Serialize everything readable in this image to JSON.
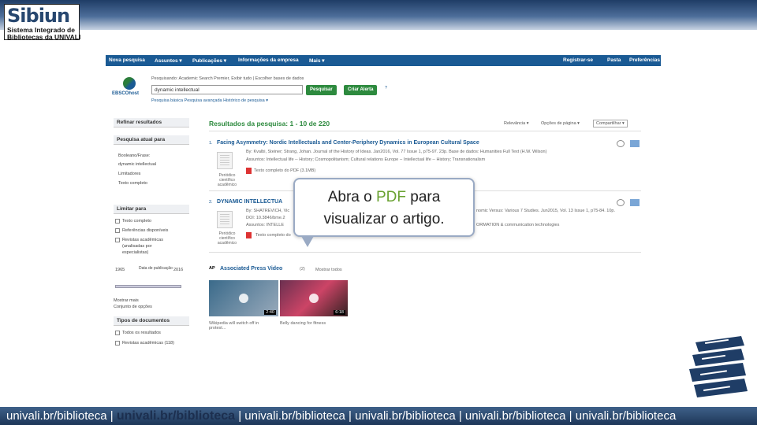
{
  "logo": {
    "title": "Sibiun",
    "line1": "Sistema Integrado de",
    "line2": "Bibliotecas da UNIVALI"
  },
  "nav": {
    "items": [
      "Nova pesquisa",
      "Assuntos ▾",
      "Publicações ▾",
      "Informações da empresa",
      "Mais ▾"
    ],
    "right": [
      "Registrar-se",
      "Pasta",
      "Preferências"
    ]
  },
  "search": {
    "scope": "Pesquisando: Academic Search Premier, Exibir tudo  |  Escolher bases de dados",
    "query": "dynamic intellectual",
    "btn_search": "Pesquisar",
    "btn_alert": "Criar Alerta",
    "help": "?",
    "links": "Pesquisa básica  Pesquisa avançada  Histórico de pesquisa ▾",
    "brand": "EBSCOhost"
  },
  "left": {
    "refine": "Refinar resultados",
    "current": "Pesquisa atual para",
    "boolean_label": "Booleano/Frase:",
    "boolean_value": "dynamic intellectual",
    "limiters": "Limitadores",
    "fulltext": "Texto completo",
    "limit_to": "Limitar para",
    "opt1": "Texto completo",
    "opt2": "Referências disponíveis",
    "opt3": "Revistas acadêmicas",
    "opt3b": "(analisadas por",
    "opt3c": "especialistas)",
    "year_from": "1965",
    "year_label": "Data de publicação",
    "year_to": "2016",
    "show_more": "Mostrar mais",
    "options": "Conjunto de opções",
    "doc_types": "Tipos de documentos",
    "dt1": "Todos os resultados",
    "dt2": "Revistas acadêmicas (118)"
  },
  "results": {
    "title": "Resultados da pesquisa: 1 - 10 de 220",
    "sort": "Relevância ▾",
    "page_opts": "Opções de página ▾",
    "share": "Compartilhar ▾",
    "r1_num": "1.",
    "r1_title": "Facing Asymmetry: Nordic Intellectuals and Center-Periphery Dynamics in European Cultural Space",
    "r1_meta1": "By: Kvalbi, Steiner; Strang, Johan. Journal of the History of Ideas. Jan2016, Vol. 77 Issue 1, p75-97. 23p. Base de dados: Humanities Full Text (H.W. Wilson)",
    "r1_meta2": "Assuntos: Intellectual life -- History; Cosmopolitanism; Cultural relations Europe -- Intellectual life -- History; Transnationalism",
    "r1_pdf": "Texto completo do PDF (3.1MB)",
    "r1_type": "Periódico científico acadêmico",
    "r2_num": "2.",
    "r2_title": "DYNAMIC INTELLECTUA",
    "r2_meta1": "By: SHATREVICH, Vic",
    "r2_meta_right": "nomic Versus: Various 7 Studies. Jun2015, Vol. 13 Issue 1, p75-84. 10p.",
    "r2_meta2": "DOI: 10.3846/bme.2",
    "r2_meta3": "Assuntos: INTELLE",
    "r2_meta_right2": "ORMATION & communication technologies",
    "r2_pdf": "Texto completo do",
    "r2_type": "Periódico científico acadêmico",
    "video_head": "Associated Press Video",
    "video_count": "(2)",
    "video_all": "Mostrar todos",
    "v1_dur": "2:40",
    "v2_dur": "6:18",
    "v1_cap": "Wikipedia will switch off in protest...",
    "v2_cap": "Belly dancing for fitness"
  },
  "tooltip": {
    "before": "Abra o ",
    "pdf": "PDF",
    "after": " para",
    "line2": "visualizar o artigo."
  },
  "footer": {
    "seg1": "univali.br/biblioteca | ",
    "hl": "univali.br/biblioteca",
    "seg2": " | univali.br/biblioteca | univali.br/biblioteca | univali.br/biblioteca | univali.br/biblioteca"
  },
  "colors": {
    "brand_blue": "#1a5a94",
    "green": "#2d8a3e",
    "pdf_green": "#6aa232",
    "header_dark": "#1f3d66"
  }
}
